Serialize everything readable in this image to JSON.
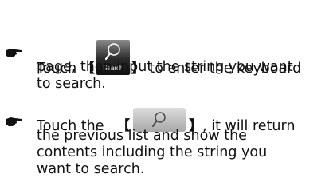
{
  "items": [
    {
      "icon": "pointing-hand-icon",
      "lines": [
        {
          "before": "Touch",
          "open_bracket": "【",
          "button_icon": "search-icon",
          "button_label": "Search",
          "close_bracket": "】",
          "after": "to enter the keyboard"
        },
        {
          "text": "page, then input the string you want"
        },
        {
          "text": "to search."
        }
      ]
    },
    {
      "icon": "pointing-hand-icon",
      "lines": [
        {
          "before": "Touch the",
          "open_bracket": "【",
          "button_icon": "search-icon",
          "close_bracket": "】",
          "after": ", it will return"
        },
        {
          "text": "the previous list and show the"
        },
        {
          "text": "contents including the string you"
        },
        {
          "text": "want to search."
        }
      ]
    }
  ]
}
